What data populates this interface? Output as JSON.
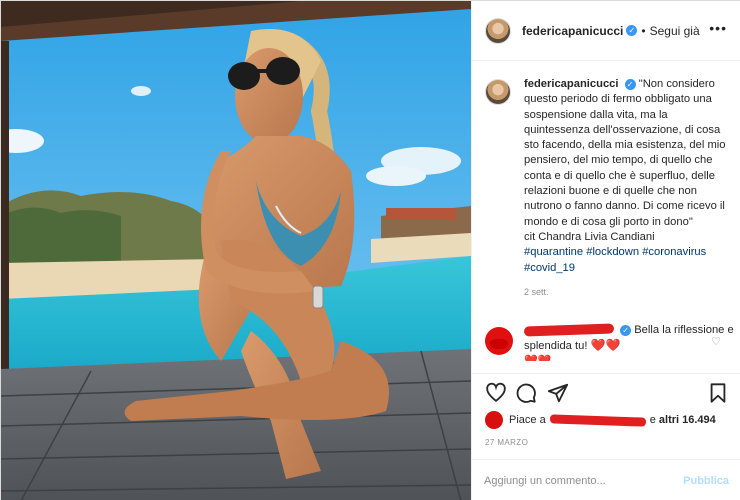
{
  "post": {
    "username": "federicapanicucci",
    "follow_status": "Segui già",
    "more_label": "•••",
    "verified_glyph": "✓"
  },
  "caption": {
    "username": "federicapanicucci",
    "text": "\"Non considero questo periodo di fermo obbligato una sospensione dalla vita, ma la quintessenza dell'osservazione, di cosa sto facendo, della mia esistenza, del mio pensiero, del mio tempo, di quello che conta e di quello che è superfluo, delle relazioni buone e di quelle che non nutrono o fanno danno. Di come ricevo il mondo e di cosa gli porto in dono\"",
    "attribution": "cit Chandra Livia Candiani",
    "hashtags": [
      "#quarantine",
      "#lockdown",
      "#coronavirus",
      "#covid_19"
    ],
    "time": "2 sett."
  },
  "comment": {
    "text": "Bella la riflessione e splendida tu!",
    "hearts": "❤️❤️"
  },
  "likes": {
    "prefix": "Piace a",
    "suffix_word": "e",
    "others": "altri 16.494"
  },
  "date": "27 MARZO",
  "add_comment": {
    "placeholder": "Aggiungi un commento...",
    "publish_label": "Pubblica"
  },
  "colors": {
    "link": "#00376b",
    "verified": "#3897f0",
    "publish_disabled": "#b2dffc"
  }
}
